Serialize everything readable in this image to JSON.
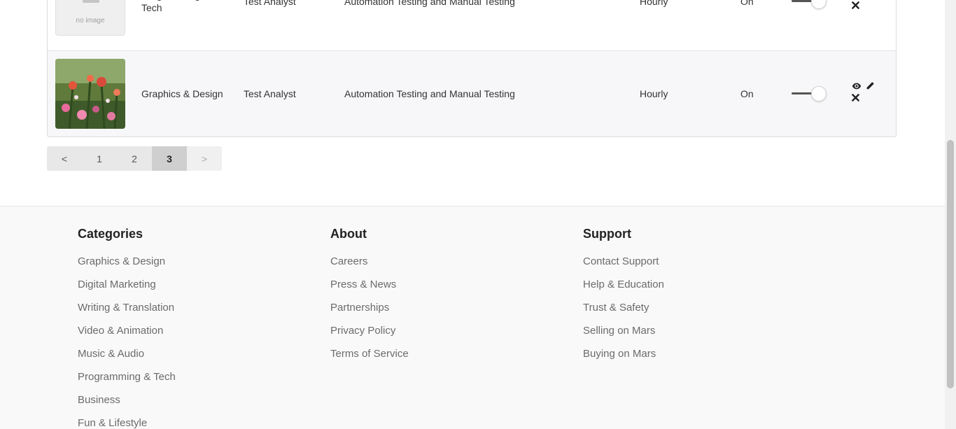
{
  "table": {
    "rows": [
      {
        "thumbnail": "no image",
        "category": "Programming & Tech",
        "title": "Test Analyst",
        "description": "Automation Testing and Manual Testing",
        "rate_type": "Hourly",
        "status": "On",
        "toggle_on": true
      },
      {
        "thumbnail": "flowers-photo",
        "category": "Graphics & Design",
        "title": "Test Analyst",
        "description": "Automation Testing and Manual Testing",
        "rate_type": "Hourly",
        "status": "On",
        "toggle_on": true
      }
    ],
    "action_icons": [
      "eye-icon",
      "pencil-icon",
      "close-icon"
    ]
  },
  "pagination": {
    "prev": "<",
    "pages": [
      "1",
      "2",
      "3"
    ],
    "current": "3",
    "next": ">"
  },
  "footer": {
    "categories": {
      "heading": "Categories",
      "links": [
        "Graphics & Design",
        "Digital Marketing",
        "Writing & Translation",
        "Video & Animation",
        "Music & Audio",
        "Programming & Tech",
        "Business",
        "Fun & Lifestyle"
      ]
    },
    "about": {
      "heading": "About",
      "links": [
        "Careers",
        "Press & News",
        "Partnerships",
        "Privacy Policy",
        "Terms of Service"
      ]
    },
    "support": {
      "heading": "Support",
      "links": [
        "Contact Support",
        "Help & Education",
        "Trust & Safety",
        "Selling on Mars",
        "Buying on Mars"
      ]
    }
  },
  "colors": {
    "page_bg": "#ffffff",
    "row_alt_bg": "#f7f7f9",
    "footer_bg": "#f9f9f9",
    "pagination_bg": "#e8e8e8",
    "pagination_active_bg": "#cfcfcf",
    "link_text": "#6b6b6b"
  }
}
